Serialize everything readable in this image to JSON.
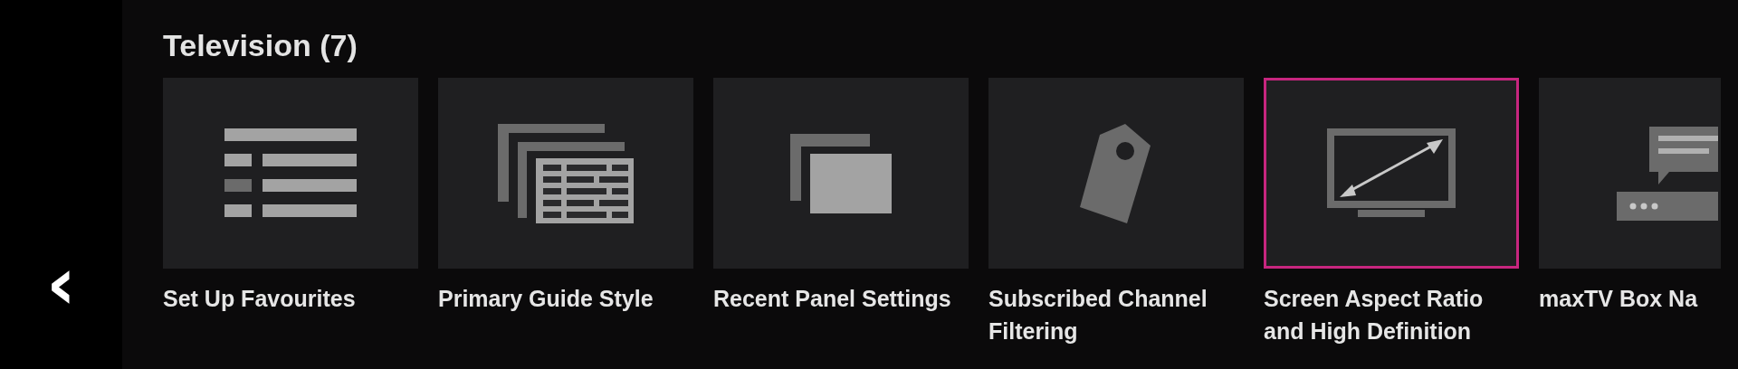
{
  "back_button": {
    "label": "‹"
  },
  "section": {
    "title": "Television (7)"
  },
  "tiles": [
    {
      "kind": "list",
      "label": "Set Up Favourites",
      "selected": false
    },
    {
      "kind": "guide",
      "label": "Primary Guide Style",
      "selected": false
    },
    {
      "kind": "panels",
      "label": "Recent Panel Settings",
      "selected": false
    },
    {
      "kind": "tag",
      "label": "Subscribed Channel Filtering",
      "selected": false
    },
    {
      "kind": "tv",
      "label": "Screen Aspect Ratio and High Definition",
      "selected": true
    },
    {
      "kind": "box",
      "label": "maxTV Box Na",
      "selected": false
    }
  ]
}
